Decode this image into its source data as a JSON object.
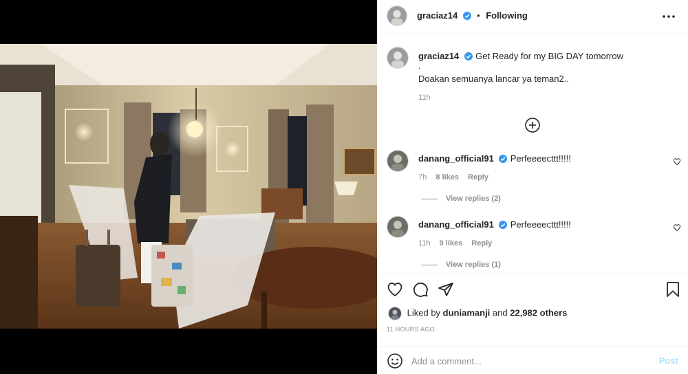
{
  "header": {
    "username": "graciaz14",
    "separator": "•",
    "follow_status": "Following"
  },
  "caption": {
    "username": "graciaz14",
    "line1": "Get Ready for my BIG DAY tomorrow",
    "line2": ".",
    "line3": "Doakan semuanya lancar ya teman2..",
    "time": "11h"
  },
  "comments": [
    {
      "username": "danang_official91",
      "text": "Perfeeeecttt!!!!!",
      "time": "7h",
      "likes": "8 likes",
      "reply": "Reply",
      "view_replies": "View replies (2)"
    },
    {
      "username": "danang_official91",
      "text": "Perfeeeecttt!!!!!",
      "time": "11h",
      "likes": "9 likes",
      "reply": "Reply",
      "view_replies": "View replies (1)"
    }
  ],
  "likes": {
    "prefix": "Liked by",
    "user": "duniamanji",
    "joiner": "and",
    "others": "22,982 others"
  },
  "timestamp": "11 HOURS AGO",
  "add_comment": {
    "placeholder": "Add a comment...",
    "post_label": "Post"
  },
  "icons": {
    "more": "more-options-icon",
    "load_more": "plus-circle-icon",
    "like": "heart-icon",
    "comment": "comment-icon",
    "share": "share-icon",
    "save": "bookmark-icon",
    "emoji": "emoji-icon",
    "verified": "verified-badge-icon"
  },
  "colors": {
    "verified": "#3897f0",
    "post_button_disabled": "#b2dffc",
    "secondary_text": "#8e8e8e"
  }
}
